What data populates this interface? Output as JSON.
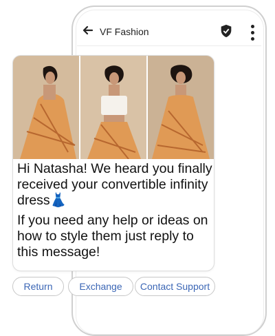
{
  "header": {
    "title": "VF Fashion"
  },
  "message": {
    "line1": "Hi Natasha! We heard you finally received your convertible infinity dress",
    "emoji": "👗",
    "line2": "If you need any help or ideas on how to style them just reply to this message!"
  },
  "images": [
    {
      "alt": "model in orange printed dress leaning"
    },
    {
      "alt": "model in white top and orange skirt"
    },
    {
      "alt": "model in orange printed halter dress"
    }
  ],
  "actions": [
    {
      "label": "Return"
    },
    {
      "label": "Exchange"
    },
    {
      "label": "Contact Support"
    }
  ],
  "colors": {
    "chip_text": "#3b66b5",
    "dress": "#e09a55",
    "background_photo": "#d2b999"
  },
  "icons": [
    "back-arrow-icon",
    "verified-shield-icon",
    "more-vertical-icon"
  ]
}
